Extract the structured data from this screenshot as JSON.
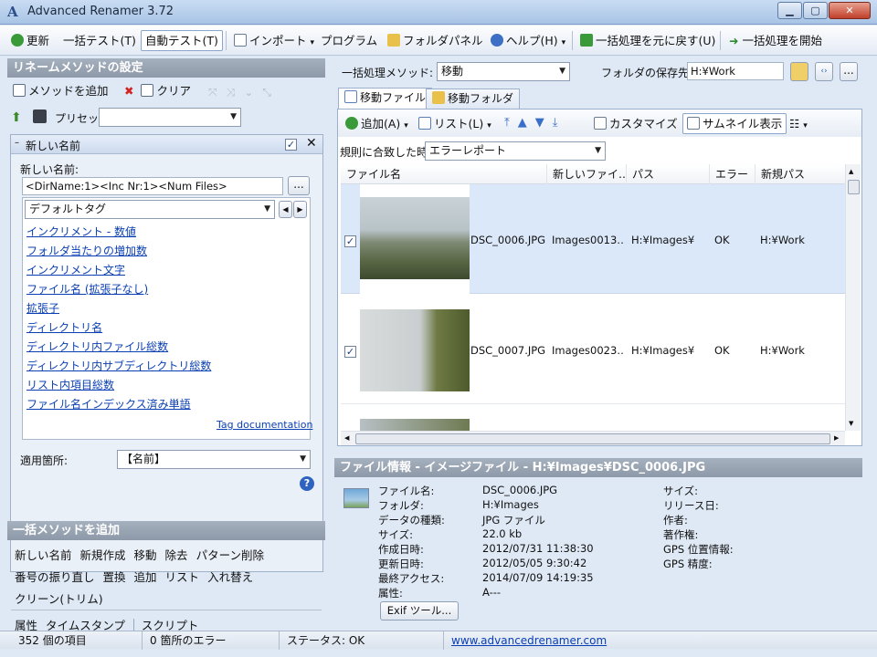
{
  "window": {
    "title": "Advanced Renamer 3.72",
    "min": "▁",
    "max": "▢",
    "close": "✕"
  },
  "toolbar": {
    "refresh": "更新",
    "batch_test": "一括テスト(T)",
    "auto_test": "自動テスト(T)",
    "import": "インポート",
    "program": "プログラム",
    "folder_panel": "フォルダパネル",
    "help": "ヘルプ(H)",
    "undo": "一括処理を元に戻す(U)",
    "start": "一括処理を開始"
  },
  "left": {
    "methods_header": "リネームメソッドの設定",
    "add_method": "メソッドを追加",
    "clear": "クリア",
    "preset_label": "プリセット:",
    "preset_value": "",
    "method_title": "新しい名前",
    "new_name_label": "新しい名前:",
    "new_name_value": "<DirName:1><Inc Nr:1><Num Files>",
    "browse": "...",
    "tags_combo": "デフォルトタグ",
    "tags": [
      "インクリメント - 数値",
      "フォルダ当たりの増加数",
      "インクリメント文字",
      "ファイル名 (拡張子なし)",
      "拡張子",
      "ディレクトリ名",
      "ディレクトリ内ファイル総数",
      "ディレクトリ内サブディレクトリ総数",
      "リスト内項目総数",
      "ファイル名インデックス済み単語"
    ],
    "tag_doc": "Tag documentation",
    "apply_label": "適用箇所:",
    "apply_value": "【名前】",
    "help_icon": "?",
    "batch_header": "一括メソッドを追加",
    "batch_row1": [
      "新しい名前",
      "新規作成",
      "移動",
      "除去",
      "パターン削除"
    ],
    "batch_row2": [
      "番号の振り直し",
      "置換",
      "追加",
      "リスト",
      "入れ替え"
    ],
    "batch_row3": [
      "クリーン(トリム)"
    ],
    "batch_row4": [
      "属性",
      "タイムスタンプ",
      "スクリプト"
    ]
  },
  "right": {
    "batch_method_label": "一括処理メソッド:",
    "batch_method_value": "移動",
    "save_folder_label": "フォルダの保存先:",
    "save_folder_value": "H:¥Work",
    "browse": "...",
    "tab_files": "移動ファイル",
    "tab_folders": "移動フォルダ",
    "add": "追加(A)",
    "list": "リスト(L)",
    "customize": "カスタマイズ",
    "thumbnail": "サムネイル表示",
    "rule_label": "規則に合致した時:",
    "rule_value": "エラーレポート",
    "columns": [
      "ファイル名",
      "新しいファイ…",
      "パス",
      "エラー",
      "新規パス"
    ],
    "rows": [
      {
        "checked": "✓",
        "name": "DSC_0006.JPG",
        "new": "Images0013…",
        "path": "H:¥Images¥",
        "err": "OK",
        "newpath": "H:¥Work"
      },
      {
        "checked": "✓",
        "name": "DSC_0007.JPG",
        "new": "Images0023…",
        "path": "H:¥Images¥",
        "err": "OK",
        "newpath": "H:¥Work"
      }
    ],
    "info_header": "ファイル情報 - イメージファイル - H:¥Images¥DSC_0006.JPG",
    "info": [
      [
        "ファイル名:",
        "DSC_0006.JPG"
      ],
      [
        "フォルダ:",
        "H:¥Images"
      ],
      [
        "データの種類:",
        "JPG ファイル"
      ],
      [
        "サイズ:",
        "22.0 kb"
      ],
      [
        "作成日時:",
        "2012/07/31 11:38:30"
      ],
      [
        "更新日時:",
        "2012/05/05 9:30:42"
      ],
      [
        "最終アクセス:",
        "2014/07/09 14:19:35"
      ],
      [
        "属性:",
        "A---"
      ]
    ],
    "info_right": [
      "サイズ:",
      "リリース日:",
      "作者:",
      "著作権:",
      "GPS 位置情報:",
      "GPS 精度:"
    ],
    "exif_button": "Exif ツール..."
  },
  "status": {
    "items": "352 個の項目",
    "errors": "0 箇所のエラー",
    "state": "ステータス: OK",
    "link": "www.advancedrenamer.com"
  },
  "colors": {
    "accent": "#2b63c6",
    "selected_row": "#dbe8f9",
    "panel_header": "#969fae"
  }
}
